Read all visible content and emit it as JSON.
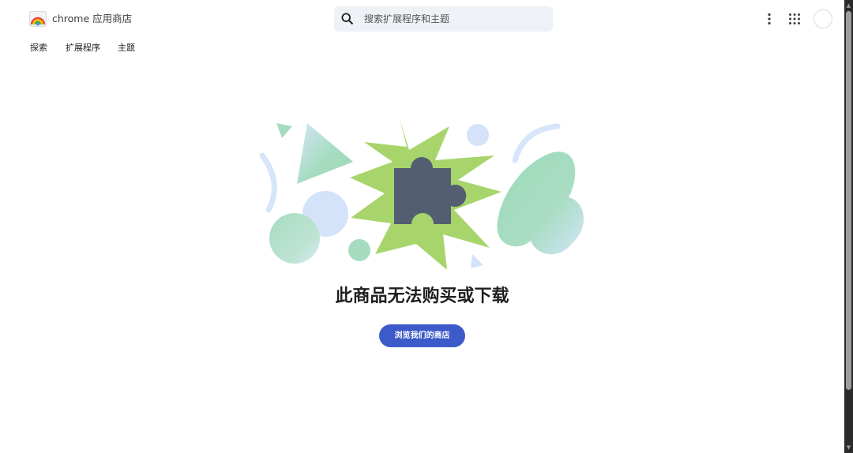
{
  "header": {
    "brand": "chrome 应用商店",
    "search_placeholder": "搜索扩展程序和主题"
  },
  "nav": {
    "items": [
      {
        "label": "探索"
      },
      {
        "label": "扩展程序"
      },
      {
        "label": "主题"
      }
    ]
  },
  "main": {
    "heading": "此商品无法购买或下载",
    "cta_label": "浏览我们的商店"
  },
  "icons": [
    "chrome-web-store-logo-icon",
    "search-icon",
    "more-vert-icon",
    "apps-grid-icon",
    "puzzle-piece-icon"
  ],
  "colors": {
    "accent": "#3c5ac8",
    "starburst": "#a8d56b",
    "puzzle": "#535f71",
    "mint": "#a5dcc0",
    "light_blue": "#d4e3fa"
  }
}
